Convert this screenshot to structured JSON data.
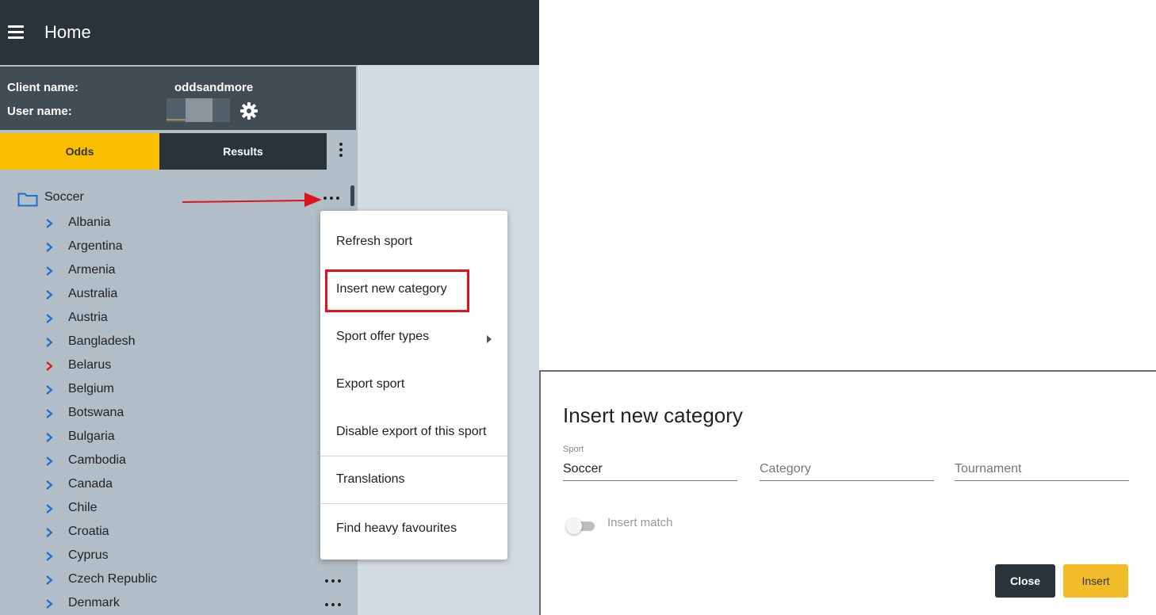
{
  "header": {
    "title": "Home",
    "menu_icon": "hamburger-icon"
  },
  "client_info": {
    "client_label": "Client name:",
    "client_value": "oddsandmore",
    "user_label": "User name:",
    "settings_icon": "gear-icon"
  },
  "tabs": [
    {
      "label": "Odds",
      "active": true
    },
    {
      "label": "Results",
      "active": false
    }
  ],
  "tree": {
    "sport": "Soccer",
    "categories": [
      "Albania",
      "Argentina",
      "Armenia",
      "Australia",
      "Austria",
      "Bangladesh",
      "Belarus",
      "Belgium",
      "Botswana",
      "Bulgaria",
      "Cambodia",
      "Canada",
      "Chile",
      "Croatia",
      "Cyprus",
      "Czech Republic",
      "Denmark"
    ],
    "highlighted_category": "Belarus"
  },
  "context_menu": {
    "items": [
      "Refresh sport",
      "Insert new category",
      "Sport offer types",
      "Export sport",
      "Disable export of this sport",
      "Translations",
      "Find heavy favourites"
    ],
    "highlighted_item": "Insert new category"
  },
  "dialog": {
    "title": "Insert new category",
    "sport_label": "Sport",
    "sport_value": "Soccer",
    "category_placeholder": "Category",
    "tournament_placeholder": "Tournament",
    "toggle_label": "Insert match",
    "toggle_on": false,
    "close_label": "Close",
    "insert_label": "Insert"
  },
  "colors": {
    "accent": "#f9bf00",
    "dark": "#2b333a",
    "highlight": "#e0121b",
    "chevron": "#1f6fd1"
  }
}
